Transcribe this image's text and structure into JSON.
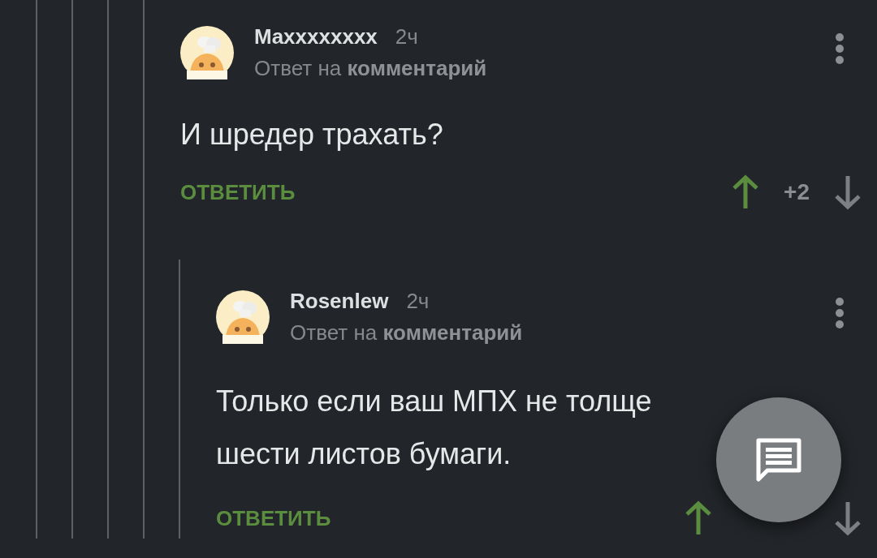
{
  "comments": [
    {
      "author": "Maxxxxxxxx",
      "time": "2ч",
      "subtitle": "Ответ на **комментарий**",
      "text": "И шредер трахать?",
      "reply_label": "ОТВЕТИТЬ",
      "rating": "+2",
      "children": [
        {
          "author": "Rosenlew",
          "time": "2ч",
          "subtitle": "Ответ на **комментарий**",
          "text": "Только если ваш МПХ не толще шести листов бумаги.",
          "reply_label": "ОТВЕТИТЬ"
        }
      ]
    }
  ],
  "fab": {
    "kind": "comments"
  }
}
